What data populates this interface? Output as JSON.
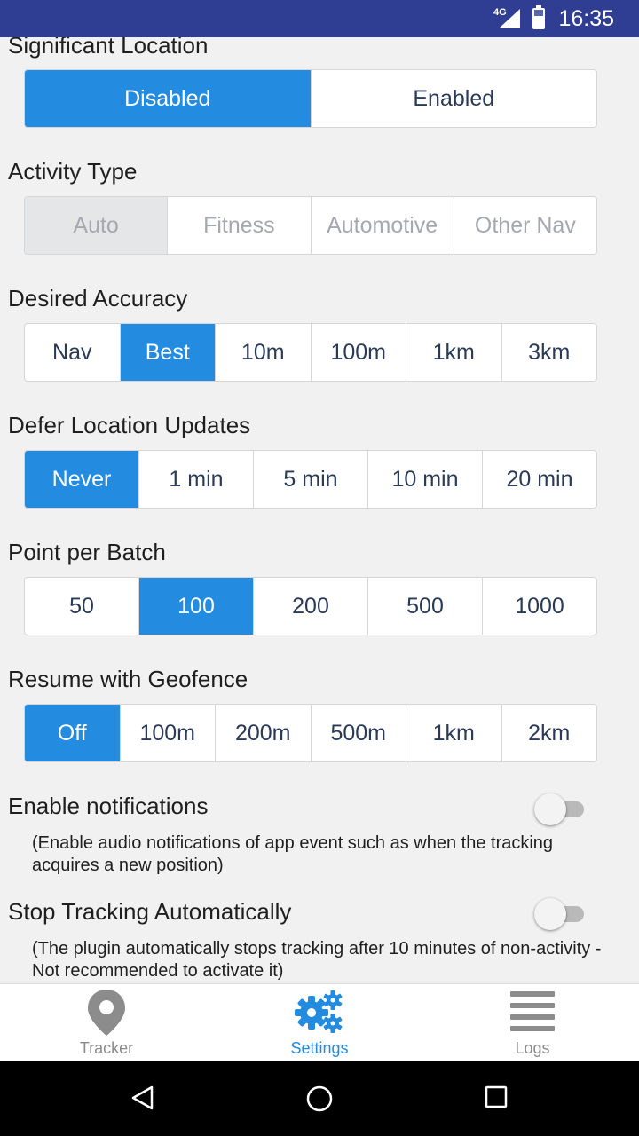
{
  "status_bar": {
    "network": "4G",
    "time": "16:35",
    "bg_color": "#2f3e93"
  },
  "colors": {
    "accent": "#238ce0",
    "inactive_text": "#2b3b57",
    "disabled_text": "#a4a9b0",
    "background": "#f1f1f1"
  },
  "settings": {
    "significant_location": {
      "title": "Significant Location",
      "options": [
        "Disabled",
        "Enabled"
      ],
      "selected": "Disabled"
    },
    "activity_type": {
      "title": "Activity Type",
      "options": [
        "Auto",
        "Fitness",
        "Automotive",
        "Other Nav"
      ],
      "selected": "Auto",
      "disabled": true
    },
    "desired_accuracy": {
      "title": "Desired Accuracy",
      "options": [
        "Nav",
        "Best",
        "10m",
        "100m",
        "1km",
        "3km"
      ],
      "selected": "Best"
    },
    "defer_location_updates": {
      "title": "Defer Location Updates",
      "options": [
        "Never",
        "1 min",
        "5 min",
        "10 min",
        "20 min"
      ],
      "selected": "Never"
    },
    "point_per_batch": {
      "title": "Point per Batch",
      "options": [
        "50",
        "100",
        "200",
        "500",
        "1000"
      ],
      "selected": "100"
    },
    "resume_with_geofence": {
      "title": "Resume with Geofence",
      "options": [
        "Off",
        "100m",
        "200m",
        "500m",
        "1km",
        "2km"
      ],
      "selected": "Off"
    },
    "enable_notifications": {
      "title": "Enable notifications",
      "description": "(Enable audio notifications of app event such as when the tracking acquires a new position)",
      "enabled": false
    },
    "stop_tracking": {
      "title": "Stop Tracking Automatically",
      "description": "(The plugin automatically stops tracking after 10 minutes of non-activity  - Not recommended to activate it)",
      "enabled": false
    }
  },
  "tabbar": {
    "tracker": {
      "label": "Tracker",
      "icon": "map-pin-icon"
    },
    "settings": {
      "label": "Settings",
      "icon": "gears-icon",
      "active": true
    },
    "logs": {
      "label": "Logs",
      "icon": "menu-lines-icon"
    }
  },
  "nav_bar": {
    "back": "back-triangle-icon",
    "home": "home-circle-icon",
    "recents": "recents-square-icon"
  }
}
